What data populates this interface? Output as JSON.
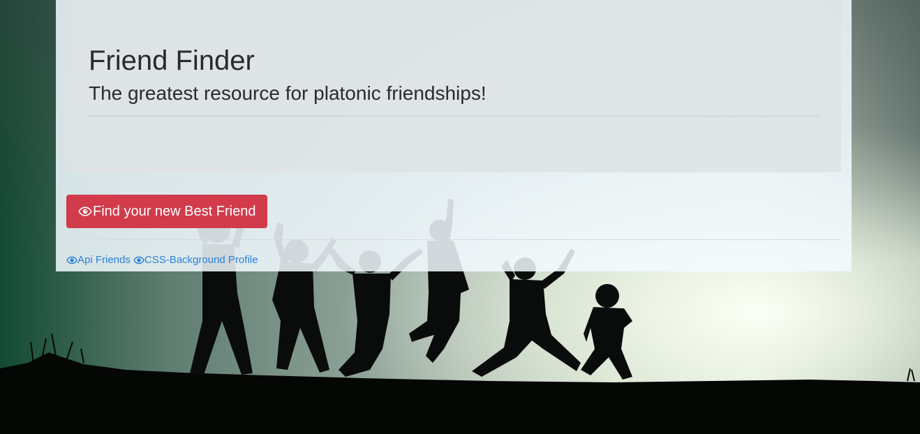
{
  "jumbotron": {
    "title": "Friend Finder",
    "subtitle": "The greatest resource for platonic friendships!"
  },
  "cta": {
    "label": "Find your new Best Friend",
    "icon": "eye-icon",
    "color": "#d13b4a"
  },
  "footer": {
    "links": [
      {
        "label": "Api Friends",
        "icon": "eye-icon"
      },
      {
        "label": "CSS-Background Profile",
        "icon": "eye-icon"
      }
    ],
    "link_color": "#2b7fd4"
  },
  "background": {
    "sky_color_left": "#1f5a45",
    "sky_color_right": "#f4fbef",
    "ground_color": "#050705"
  }
}
